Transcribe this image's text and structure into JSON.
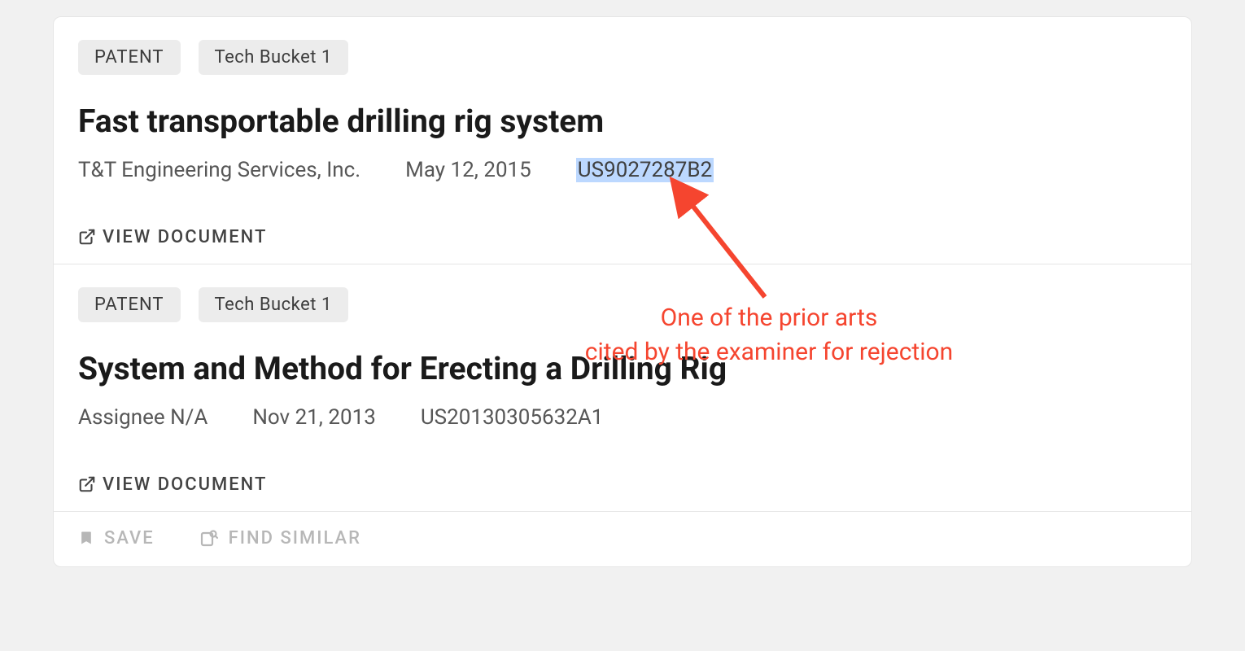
{
  "results": [
    {
      "type_label": "PATENT",
      "bucket_label": "Tech Bucket 1",
      "title": "Fast transportable drilling rig system",
      "assignee": "T&T Engineering Services, Inc.",
      "date": "May 12, 2015",
      "pub_number": "US9027287B2",
      "pub_highlighted": true,
      "view_label": "VIEW DOCUMENT"
    },
    {
      "type_label": "PATENT",
      "bucket_label": "Tech Bucket 1",
      "title": "System and Method for Erecting a Drilling Rig",
      "assignee": "Assignee N/A",
      "date": "Nov 21, 2013",
      "pub_number": "US20130305632A1",
      "pub_highlighted": false,
      "view_label": "VIEW DOCUMENT"
    }
  ],
  "footer": {
    "save_label": "SAVE",
    "find_similar_label": "FIND SIMILAR"
  },
  "annotation": {
    "line1": "One of the prior arts",
    "line2": "cited by the examiner for rejection"
  }
}
